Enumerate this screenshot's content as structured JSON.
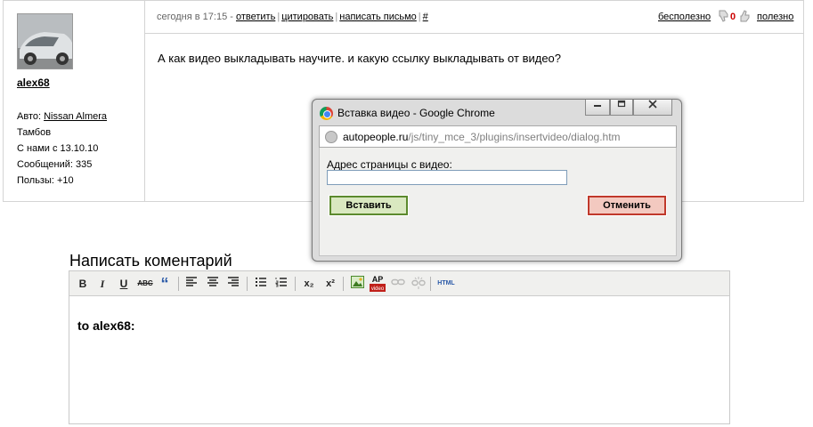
{
  "post": {
    "author": "alex68",
    "info": {
      "car_label": "Авто:",
      "car": "Nissan Almera",
      "city": "Тамбов",
      "since": "С нами с 13.10.10",
      "messages": "Сообщений: 335",
      "useful": "Пользы: +10"
    },
    "meta": {
      "date": "сегодня в 17:15 -",
      "reply": "ответить",
      "quote": "цитировать",
      "write_letter": "написать письмо",
      "link": "#"
    },
    "rating": {
      "useless": "бесполезно",
      "count": "0",
      "useful": "полезно"
    },
    "text": "А как видео выкладывать научите. и какую ссылку выкладывать от видео?"
  },
  "comment": {
    "title": "Написать коментарий",
    "body": "to alex68:",
    "toolbar": {
      "bold": "B",
      "italic": "I",
      "underline": "U",
      "strike": "ABC",
      "quote": "“",
      "sub": "x₂",
      "sup": "x²",
      "html": "HTML"
    }
  },
  "popup": {
    "title": "Вставка видео - Google Chrome",
    "url_host": "autopeople.ru",
    "url_path": "/js/tiny_mce_3/plugins/insertvideo/dialog.htm",
    "field_label": "Адрес страницы с видео:",
    "field_value": "",
    "insert_label": "Вставить",
    "cancel_label": "Отменить"
  },
  "colors": {
    "rating_count": "#cc0000",
    "insert_border": "#5c8a2e",
    "cancel_border": "#c0392b"
  }
}
